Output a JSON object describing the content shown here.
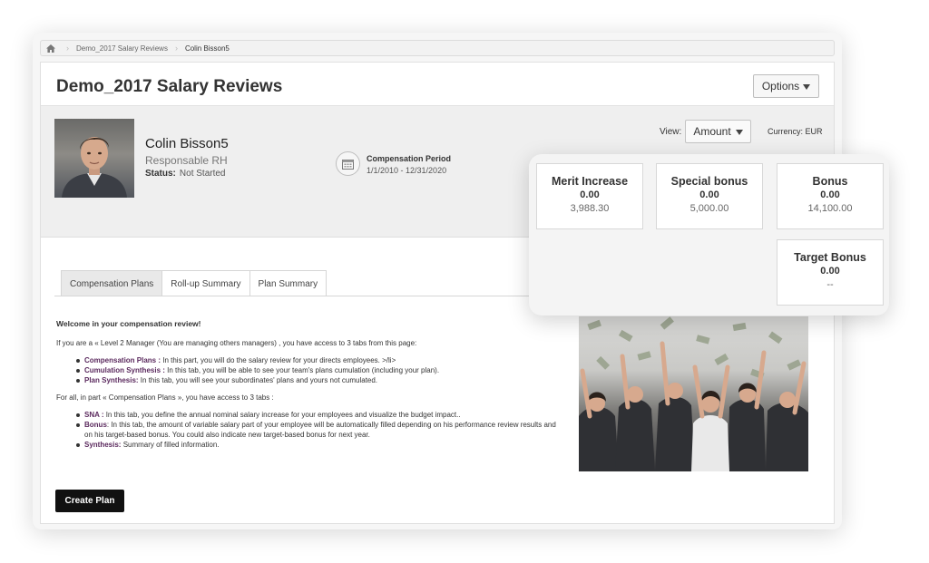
{
  "breadcrumb": {
    "items": [
      "Demo_2017 Salary Reviews",
      "Colin Bisson5"
    ]
  },
  "page": {
    "title": "Demo_2017 Salary Reviews",
    "options_label": "Options"
  },
  "employee": {
    "name": "Colin Bisson5",
    "role": "Responsable RH",
    "status_label": "Status:",
    "status_value": "Not Started"
  },
  "period": {
    "label": "Compensation Period",
    "value": "1/1/2010 - 12/31/2020"
  },
  "view": {
    "label": "View:",
    "value": "Amount",
    "currency": "Currency: EUR"
  },
  "stats": [
    {
      "title": "Merit Increase",
      "value": "0.00",
      "sub": "3,988.30"
    },
    {
      "title": "Special bonus",
      "value": "0.00",
      "sub": "5,000.00"
    },
    {
      "title": "Bonus",
      "value": "0.00",
      "sub": "14,100.00"
    },
    {
      "title": "Target Bonus",
      "value": "0.00",
      "sub": "--"
    }
  ],
  "tabs": [
    {
      "label": "Compensation Plans",
      "active": true
    },
    {
      "label": "Roll-up Summary",
      "active": false
    },
    {
      "label": "Plan Summary",
      "active": false
    }
  ],
  "content": {
    "welcome": "Welcome in your compensation review!",
    "intro": "If you are a « Level 2 Manager (You are managing others managers) , you have access to 3 tabs from this page:",
    "list1": [
      {
        "key": "Compensation Plans :",
        "text": " In this part, you will do the salary review for your directs employees. >/li>"
      },
      {
        "key": "Cumulation Synthesis :",
        "text": " In this tab, you will be able to see your team's plans cumulation (including your plan)."
      },
      {
        "key": "Plan Synthesis:",
        "text": " In this tab, you will see your subordinates' plans and yours not cumulated."
      }
    ],
    "intro2": "For all, in part « Compensation Plans », you have access to 3 tabs :",
    "list2": [
      {
        "key": "SNA :",
        "text": " In this tab, you define the annual nominal salary increase for your employees and visualize the budget impact.."
      },
      {
        "key": "Bonus",
        "text": ": In this tab, the amount of variable salary part of your employee will be automatically filled depending on his performance review results and on his target-based bonus. You could also indicate new target-based bonus for next year."
      },
      {
        "key": "Synthesis:",
        "text": " Summary of filled information."
      }
    ]
  },
  "actions": {
    "create_plan": "Create Plan"
  }
}
